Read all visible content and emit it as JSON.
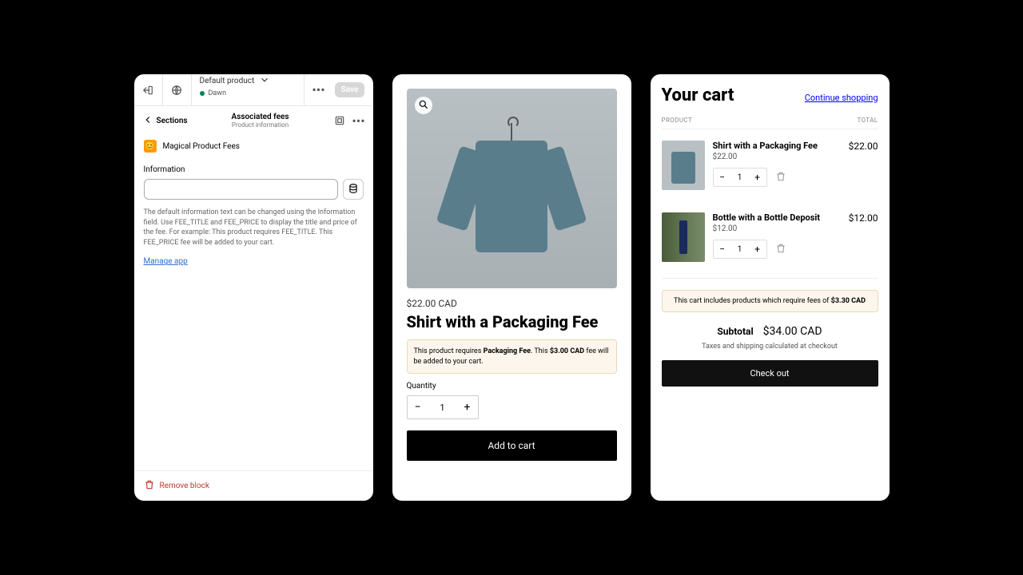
{
  "editor": {
    "product_selector": "Default product",
    "theme_name": "Dawn",
    "save_label": "Save",
    "back_label": "Sections",
    "section_title": "Associated fees",
    "section_subtitle": "Product information",
    "app_name": "Magical Product Fees",
    "info_label": "Information",
    "info_help": "The default information text can be changed using the Information field. Use FEE_TITLE and FEE_PRICE to display the title and price of the fee. For example: This product requires FEE_TITLE. This FEE_PRICE fee will be added to your cart.",
    "manage_app": "Manage app",
    "remove_block": "Remove block"
  },
  "product": {
    "price": "$22.00 CAD",
    "title": "Shirt with a Packaging Fee",
    "fee_notice_pre": "This product requires ",
    "fee_notice_title": "Packaging Fee",
    "fee_notice_mid": ". This ",
    "fee_notice_price": "$3.00 CAD",
    "fee_notice_post": " fee will be added to your cart.",
    "quantity_label": "Quantity",
    "quantity": "1",
    "add_to_cart": "Add to cart"
  },
  "cart": {
    "title": "Your cart",
    "continue": "Continue shopping",
    "col_product": "PRODUCT",
    "col_total": "TOTAL",
    "items": [
      {
        "name": "Shirt with a Packaging Fee",
        "price": "$22.00",
        "qty": "1",
        "total": "$22.00"
      },
      {
        "name": "Bottle with a Bottle Deposit",
        "price": "$12.00",
        "qty": "1",
        "total": "$12.00"
      }
    ],
    "fee_notice_pre": "This cart includes products which require fees of ",
    "fee_notice_amount": "$3.30 CAD",
    "subtotal_label": "Subtotal",
    "subtotal": "$34.00 CAD",
    "tax_note": "Taxes and shipping calculated at checkout",
    "checkout": "Check out"
  }
}
